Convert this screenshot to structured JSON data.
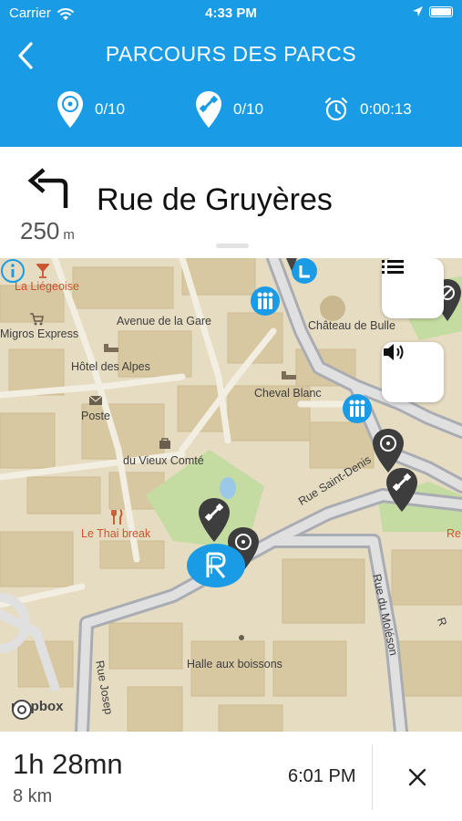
{
  "status_bar": {
    "carrier": "Carrier",
    "time": "4:33 PM"
  },
  "header": {
    "title": "PARCOURS DES PARCS",
    "stats": {
      "visited": "0/10",
      "discovered": "0/10",
      "elapsed": "0:00:13"
    }
  },
  "navigation": {
    "distance_value": "250",
    "distance_unit": "m",
    "street": "Rue de Gruyères"
  },
  "map": {
    "labels": {
      "la_liegeoise": "La Liégeoise",
      "migros": "Migros Express",
      "avenue_gare": "Avenue de la Gare",
      "chateau": "Château de Bulle",
      "hotel_alpes": "Hôtel des Alpes",
      "cheval_blanc": "Cheval Blanc",
      "poste": "Poste",
      "vieux_comte": "du Vieux Comté",
      "thai_break": "Le Thai break",
      "rue_saint_denis": "Rue Saint-Denis",
      "rue_moleson": "Rue du Moléson",
      "halle": "Halle aux boissons",
      "rue_joseph": "Rue Josep",
      "edge_re": "Re",
      "edge_r": "R"
    },
    "attribution": "mapbox"
  },
  "trip": {
    "duration": "1h 28mn",
    "distance": "8 km",
    "arrival": "6:01 PM"
  },
  "colors": {
    "brand": "#1a9be6",
    "map_background": "#e6dcc2",
    "road": "#a9adb3",
    "park": "#c4dba1"
  }
}
